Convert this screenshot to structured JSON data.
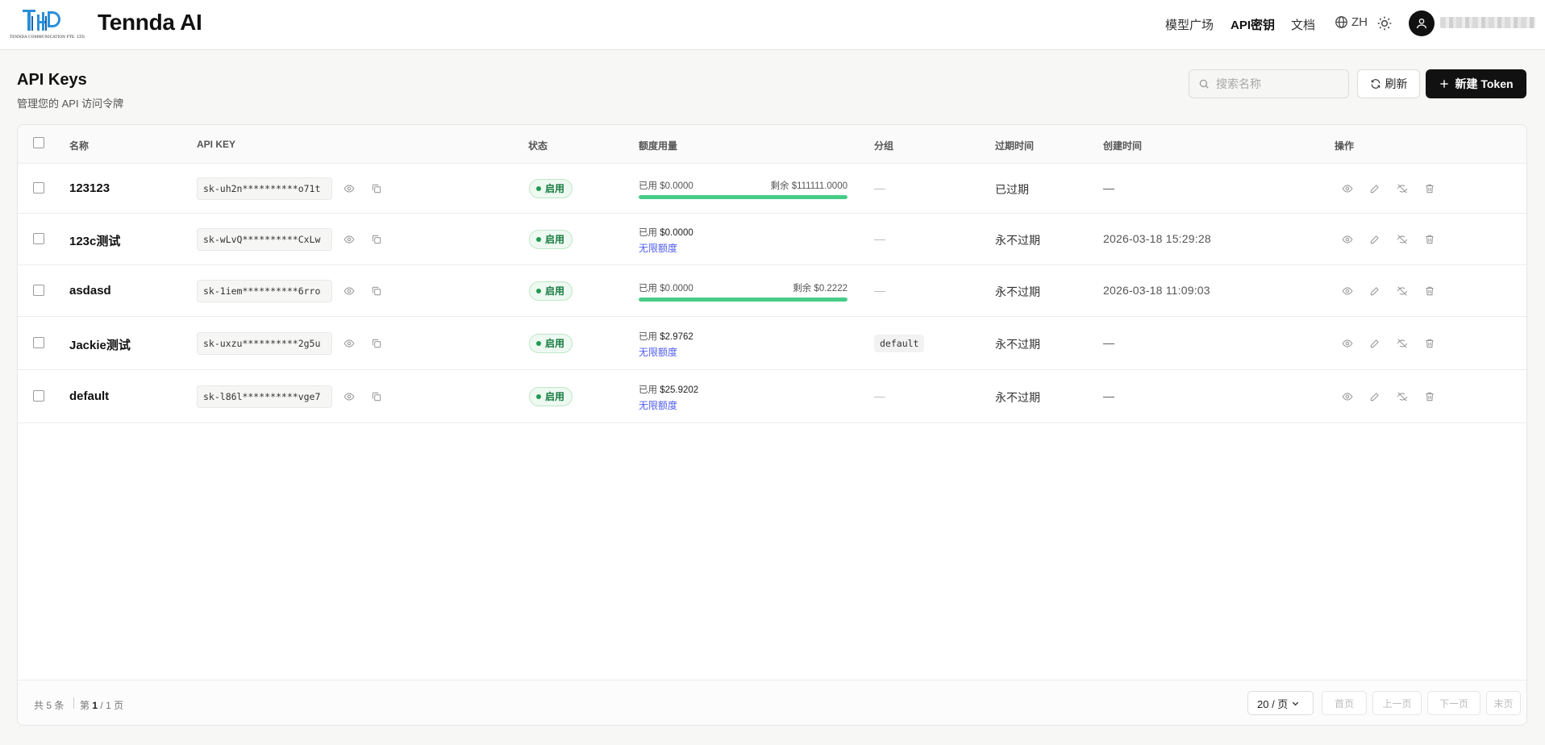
{
  "header": {
    "brand": "Tennda AI",
    "logo_caption": "TENNDA COMMUNICATION PTE. LTD.",
    "nav": [
      "模型广场",
      "API密钥",
      "文档"
    ],
    "active_nav": "API密钥",
    "lang": "ZH",
    "username": "(blurred)"
  },
  "page": {
    "title": "API Keys",
    "subtitle": "管理您的 API 访问令牌",
    "search_placeholder": "搜索名称",
    "refresh_label": "刷新",
    "new_label": "新建 Token"
  },
  "table": {
    "columns": [
      "名称",
      "API KEY",
      "状态",
      "额度用量",
      "分组",
      "过期时间",
      "创建时间",
      "操作"
    ],
    "rows": [
      {
        "name": "123123",
        "key": "sk-uh2n**********o71t",
        "status": "启用",
        "used_label": "已用",
        "used": "$0.0000",
        "remain_label": "剩余",
        "remain": "$111111.0000",
        "remain_fraction": 1.0,
        "unlimited": "",
        "group": "—",
        "expiry": "已过期",
        "created": "—"
      },
      {
        "name": "123c测试",
        "key": "sk-wLvQ**********CxLw",
        "status": "启用",
        "used_label": "已用",
        "used": "$0.0000",
        "remain_label": "",
        "remain": "",
        "remain_fraction": null,
        "unlimited": "无限额度",
        "group": "—",
        "expiry": "永不过期",
        "created": "2026-03-18 15:29:28"
      },
      {
        "name": "asdasd",
        "key": "sk-1iem**********6rro",
        "status": "启用",
        "used_label": "已用",
        "used": "$0.0000",
        "remain_label": "剩余",
        "remain": "$0.2222",
        "remain_fraction": 1.0,
        "unlimited": "",
        "group": "—",
        "expiry": "永不过期",
        "created": "2026-03-18 11:09:03"
      },
      {
        "name": "Jackie测试",
        "key": "sk-uxzu**********2g5u",
        "status": "启用",
        "used_label": "已用",
        "used": "$2.9762",
        "remain_label": "",
        "remain": "",
        "remain_fraction": null,
        "unlimited": "无限额度",
        "group": "default",
        "expiry": "永不过期",
        "created": "—"
      },
      {
        "name": "default",
        "key": "sk-l86l**********vge7",
        "status": "启用",
        "used_label": "已用",
        "used": "$25.9202",
        "remain_label": "",
        "remain": "",
        "remain_fraction": null,
        "unlimited": "无限额度",
        "group": "—",
        "expiry": "永不过期",
        "created": "—"
      }
    ]
  },
  "footer": {
    "total_prefix": "共",
    "total_count": "5",
    "total_suffix": "条",
    "page_prefix": "第",
    "page_current": "1",
    "page_of": "/",
    "page_total": "1",
    "page_suffix": "页",
    "page_size": "20 / 页",
    "buttons": [
      "首页",
      "上一页",
      "下一页",
      "末页"
    ]
  },
  "colors": {
    "accent": "#111111",
    "status_green": "#1e9b52",
    "progress_green": "#47cc88",
    "link_blue": "#4f5cf0"
  }
}
